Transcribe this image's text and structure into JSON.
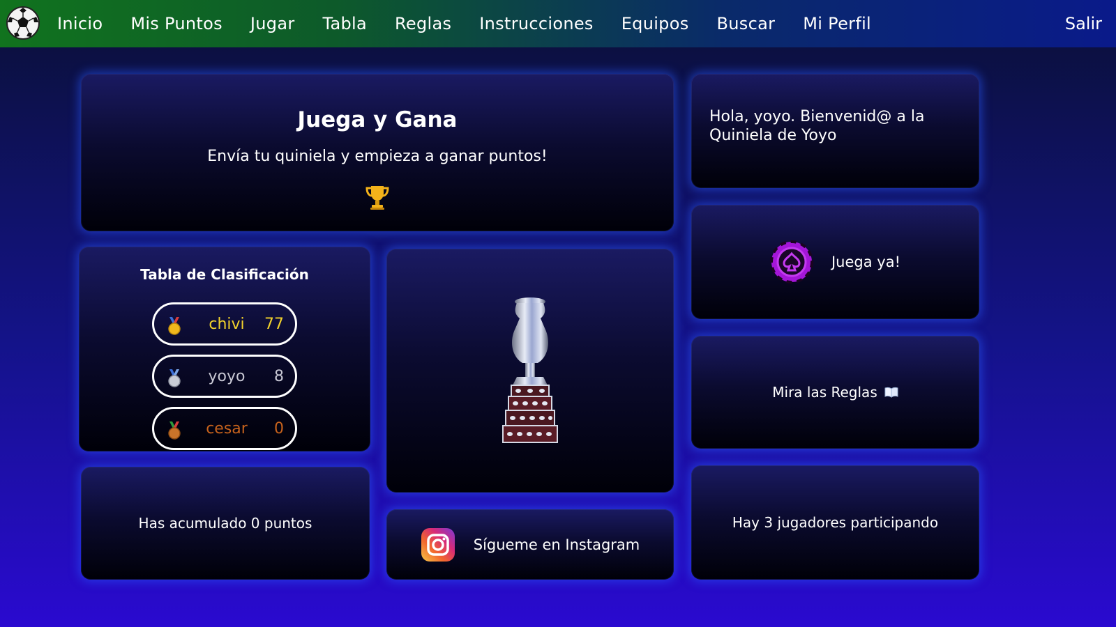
{
  "nav": {
    "logo_icon": "soccer-ball-icon",
    "items": [
      {
        "label": "Inicio"
      },
      {
        "label": "Mis Puntos"
      },
      {
        "label": "Jugar"
      },
      {
        "label": "Tabla"
      },
      {
        "label": "Reglas"
      },
      {
        "label": "Instrucciones"
      },
      {
        "label": "Equipos"
      },
      {
        "label": "Buscar"
      },
      {
        "label": "Mi Perfil"
      }
    ],
    "logout": "Salir"
  },
  "hero": {
    "title": "Juega y Gana",
    "subtitle": "Envía tu quiniela y empieza a ganar puntos!",
    "icon": "trophy-icon"
  },
  "welcome": {
    "text": "Hola, yoyo. Bienvenid@ a la Quiniela de Yoyo"
  },
  "play": {
    "label": "Juega ya!",
    "icon": "poker-chip-icon"
  },
  "rules": {
    "label": "Mira las Reglas",
    "icon": "open-book-icon"
  },
  "players": {
    "text": "Hay 3 jugadores participando"
  },
  "leaderboard": {
    "title": "Tabla de Clasificación",
    "rows": [
      {
        "medal": "gold-medal-icon",
        "name": "chivi",
        "points": "77",
        "color": "#f2d22c"
      },
      {
        "medal": "silver-medal-icon",
        "name": "yoyo",
        "points": "8",
        "color": "#c8c8d4"
      },
      {
        "medal": "bronze-medal-icon",
        "name": "cesar",
        "points": "0",
        "color": "#c6621c"
      }
    ]
  },
  "cup": {
    "icon": "copa-america-trophy-image"
  },
  "points": {
    "text": "Has acumulado 0 puntos"
  },
  "instagram": {
    "label": "Sígueme en Instagram",
    "icon": "instagram-icon"
  },
  "colors": {
    "accent_purple": "#b020e0",
    "gold": "#f2d22c",
    "glow": "#2f5cff"
  }
}
